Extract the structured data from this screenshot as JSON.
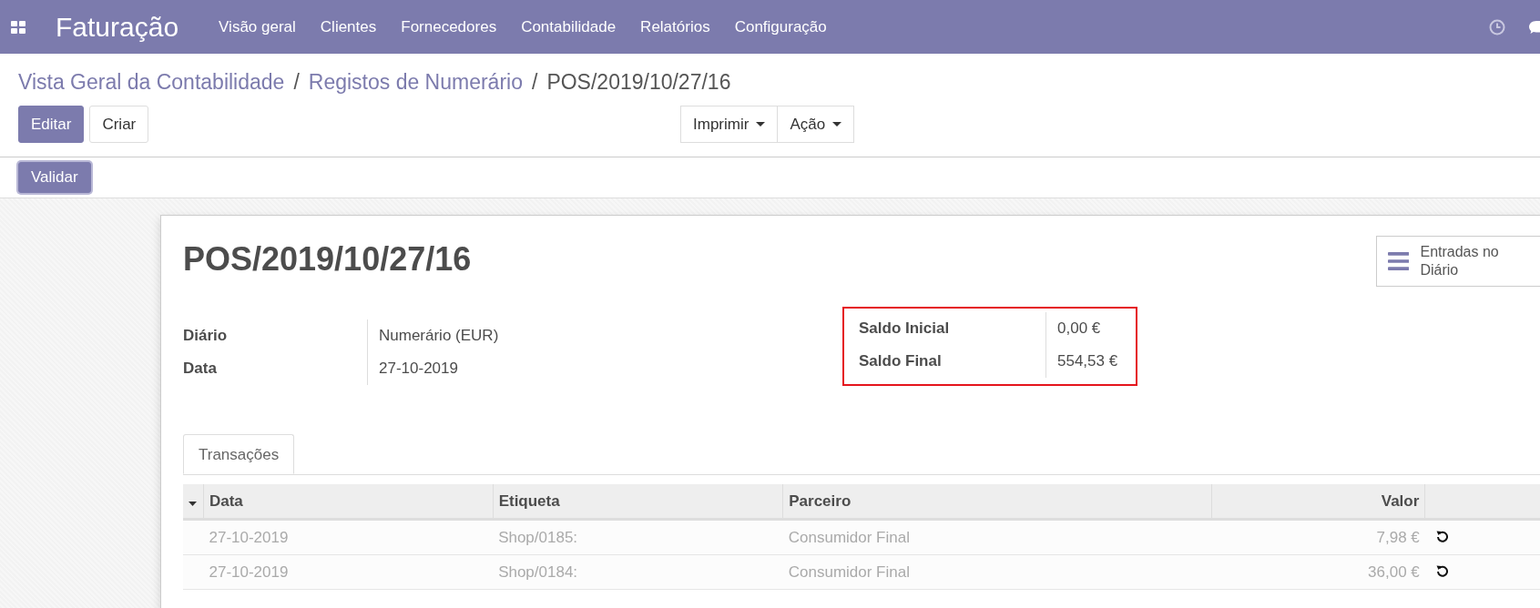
{
  "navbar": {
    "app_title": "Faturação",
    "menu": [
      "Visão geral",
      "Clientes",
      "Fornecedores",
      "Contabilidade",
      "Relatórios",
      "Configuração"
    ]
  },
  "breadcrumb": [
    {
      "kind": "link",
      "label": "Vista Geral da Contabilidade"
    },
    {
      "kind": "separator",
      "label": "/"
    },
    {
      "kind": "link",
      "label": "Registos de Numerário"
    },
    {
      "kind": "separator",
      "label": "/"
    },
    {
      "kind": "current",
      "label": "POS/2019/10/27/16"
    }
  ],
  "control_buttons": [
    {
      "label": "Editar",
      "primary": true
    },
    {
      "label": "Criar",
      "primary": false
    }
  ],
  "dropdowns": [
    "Imprimir",
    "Ação"
  ],
  "status_buttons": [
    "Validar"
  ],
  "sheet": {
    "title": "POS/2019/10/27/16",
    "smart_button": "Entradas no Diário",
    "fields": [
      {
        "label": "Diário",
        "value": "Numerário (EUR)"
      },
      {
        "label": "Data",
        "value": "27-10-2019"
      }
    ],
    "balances": [
      {
        "label": "Saldo Inicial",
        "value": "0,00 €"
      },
      {
        "label": "Saldo Final",
        "value": "554,53 €"
      }
    ],
    "tabs": [
      {
        "label": "Transações",
        "selected": true
      }
    ],
    "table": {
      "columns": [
        "Data",
        "Etiqueta",
        "Parceiro",
        "Valor"
      ],
      "rows": [
        {
          "cells": [
            "27-10-2019",
            "Shop/0185:",
            "Consumidor Final",
            "7,98 €"
          ],
          "disabled": true
        },
        {
          "cells": [
            "27-10-2019",
            "Shop/0184:",
            "Consumidor Final",
            "36,00 €"
          ],
          "disabled": true
        }
      ]
    }
  }
}
